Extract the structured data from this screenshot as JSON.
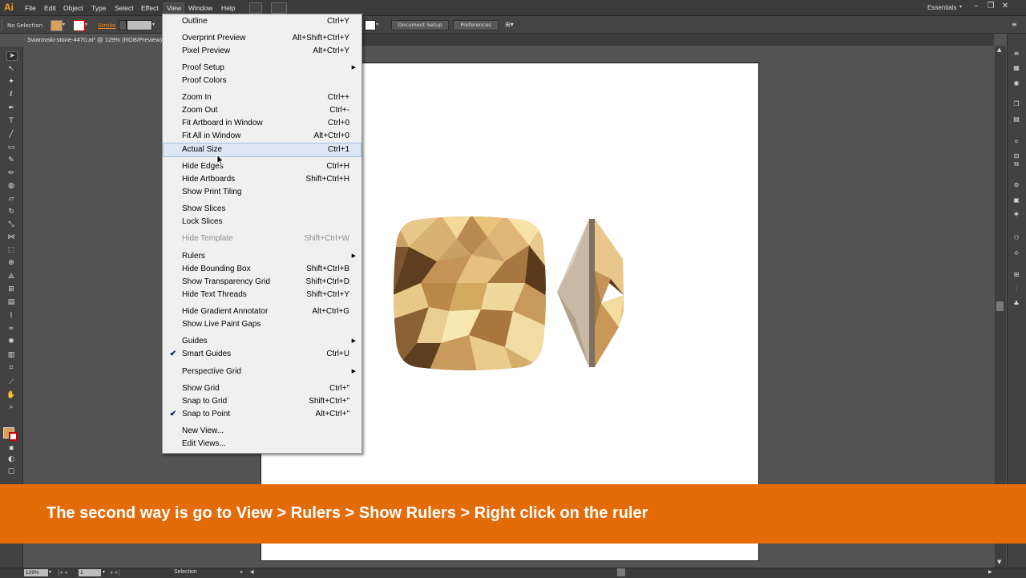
{
  "app": {
    "logo": "Ai",
    "workspace": "Essentials"
  },
  "menubar": {
    "items": [
      "File",
      "Edit",
      "Object",
      "Type",
      "Select",
      "Effect",
      "View",
      "Window",
      "Help"
    ],
    "active": "View"
  },
  "controlbar": {
    "selection": "No Selection",
    "stroke_label": "Stroke",
    "document_setup": "Document Setup",
    "preferences": "Preferences"
  },
  "document": {
    "tab_title": "Swarovski-stone-4470.ai* @ 129% (RGB/Preview)"
  },
  "statusbar": {
    "zoom": "129%",
    "artboard": "1",
    "tool": "Selection"
  },
  "view_menu": {
    "items": [
      {
        "label": "Outline",
        "shortcut": "Ctrl+Y"
      },
      {
        "label": "Overprint Preview",
        "shortcut": "Alt+Shift+Ctrl+Y"
      },
      {
        "label": "Pixel Preview",
        "shortcut": "Alt+Ctrl+Y"
      },
      {
        "label": "Proof Setup",
        "shortcut": "",
        "submenu": true
      },
      {
        "label": "Proof Colors",
        "shortcut": ""
      },
      {
        "label": "Zoom In",
        "shortcut": "Ctrl++"
      },
      {
        "label": "Zoom Out",
        "shortcut": "Ctrl+-"
      },
      {
        "label": "Fit Artboard in Window",
        "shortcut": "Ctrl+0"
      },
      {
        "label": "Fit All in Window",
        "shortcut": "Alt+Ctrl+0"
      },
      {
        "label": "Actual Size",
        "shortcut": "Ctrl+1",
        "highlighted": true
      },
      {
        "label": "Hide Edges",
        "shortcut": "Ctrl+H"
      },
      {
        "label": "Hide Artboards",
        "shortcut": "Shift+Ctrl+H"
      },
      {
        "label": "Show Print Tiling",
        "shortcut": ""
      },
      {
        "label": "Show Slices",
        "shortcut": ""
      },
      {
        "label": "Lock Slices",
        "shortcut": ""
      },
      {
        "label": "Hide Template",
        "shortcut": "Shift+Ctrl+W",
        "disabled": true
      },
      {
        "label": "Rulers",
        "shortcut": "",
        "submenu": true
      },
      {
        "label": "Hide Bounding Box",
        "shortcut": "Shift+Ctrl+B"
      },
      {
        "label": "Show Transparency Grid",
        "shortcut": "Shift+Ctrl+D"
      },
      {
        "label": "Hide Text Threads",
        "shortcut": "Shift+Ctrl+Y"
      },
      {
        "label": "Hide Gradient Annotator",
        "shortcut": "Alt+Ctrl+G"
      },
      {
        "label": "Show Live Paint Gaps",
        "shortcut": ""
      },
      {
        "label": "Guides",
        "shortcut": "",
        "submenu": true
      },
      {
        "label": "Smart Guides",
        "shortcut": "Ctrl+U",
        "checked": true
      },
      {
        "label": "Perspective Grid",
        "shortcut": "",
        "submenu": true
      },
      {
        "label": "Show Grid",
        "shortcut": "Ctrl+\""
      },
      {
        "label": "Snap to Grid",
        "shortcut": "Shift+Ctrl+\""
      },
      {
        "label": "Snap to Point",
        "shortcut": "Alt+Ctrl+\"",
        "checked": true
      },
      {
        "label": "New View...",
        "shortcut": ""
      },
      {
        "label": "Edit Views...",
        "shortcut": ""
      }
    ]
  },
  "caption": {
    "text": "The second way is go to View > Rulers > Show Rulers > Right click on the ruler"
  },
  "colors": {
    "accent_orange": "#e36c09",
    "highlight": "#dde6f3"
  }
}
